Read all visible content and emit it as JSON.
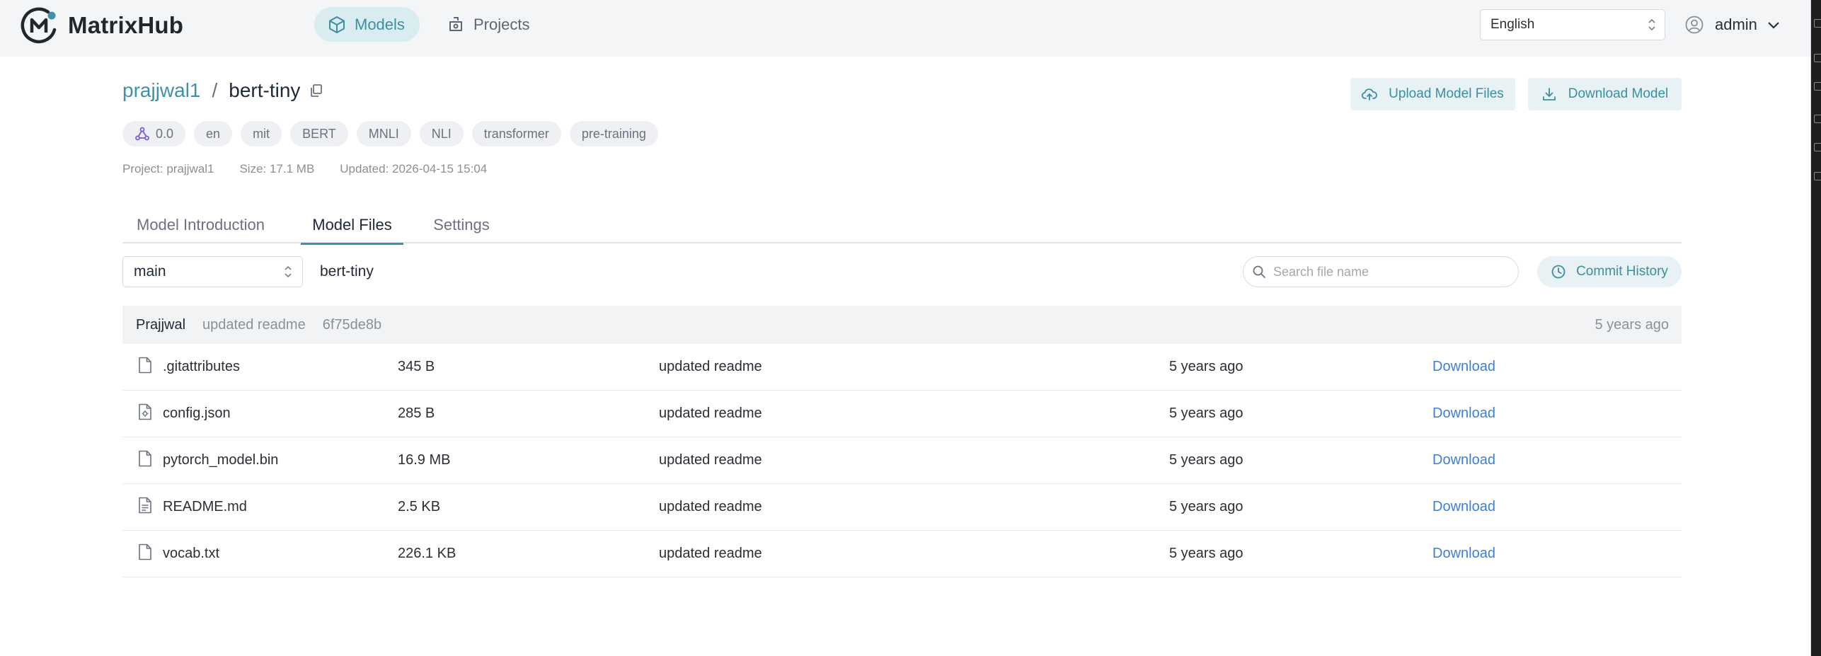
{
  "app": {
    "name": "MatrixHub",
    "nav": [
      {
        "label": "Models",
        "icon": "cube-icon",
        "active": true
      },
      {
        "label": "Projects",
        "icon": "puzzle-icon",
        "active": false
      }
    ],
    "language": "English",
    "user": "admin"
  },
  "repo": {
    "owner": "prajjwal1",
    "separator": "/",
    "name": "bert-tiny",
    "upload_label": "Upload Model Files",
    "download_label": "Download Model",
    "tags": [
      "0.0",
      "en",
      "mit",
      "BERT",
      "MNLI",
      "NLI",
      "transformer",
      "pre-training"
    ],
    "meta": {
      "project": "Project: prajjwal1",
      "size": "Size: 17.1 MB",
      "updated": "Updated: 2026-04-15 15:04"
    }
  },
  "tabs": [
    {
      "label": "Model Introduction",
      "active": false
    },
    {
      "label": "Model Files",
      "active": true
    },
    {
      "label": "Settings",
      "active": false
    }
  ],
  "files_toolbar": {
    "branch": "main",
    "path": "bert-tiny",
    "search_placeholder": "Search file name",
    "commit_history_label": "Commit History"
  },
  "last_commit": {
    "author": "Prajjwal",
    "message": "updated readme",
    "hash": "6f75de8b",
    "time": "5 years ago"
  },
  "files": [
    {
      "name": ".gitattributes",
      "size": "345 B",
      "message": "updated readme",
      "time": "5 years ago",
      "action": "Download",
      "icon": "file-icon"
    },
    {
      "name": "config.json",
      "size": "285 B",
      "message": "updated readme",
      "time": "5 years ago",
      "action": "Download",
      "icon": "config-file-icon"
    },
    {
      "name": "pytorch_model.bin",
      "size": "16.9 MB",
      "message": "updated readme",
      "time": "5 years ago",
      "action": "Download",
      "icon": "file-icon"
    },
    {
      "name": "README.md",
      "size": "2.5 KB",
      "message": "updated readme",
      "time": "5 years ago",
      "action": "Download",
      "icon": "text-file-icon"
    },
    {
      "name": "vocab.txt",
      "size": "226.1 KB",
      "message": "updated readme",
      "time": "5 years ago",
      "action": "Download",
      "icon": "file-icon"
    }
  ],
  "colors": {
    "accent": "#3a93a8",
    "accent_bg": "#e8f1f4",
    "link": "#3d7fd6",
    "header_bg": "#f4f5f7"
  }
}
